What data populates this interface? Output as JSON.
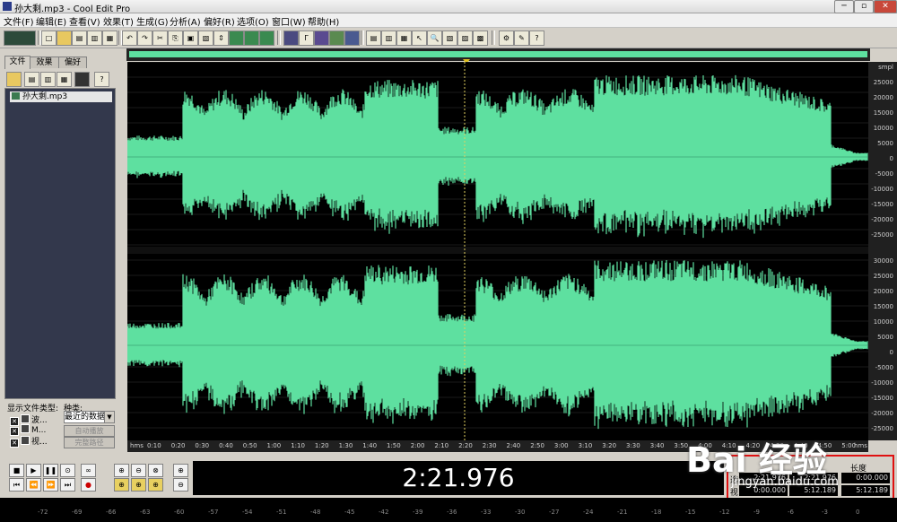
{
  "window": {
    "title": "孙大剩.mp3 - Cool Edit Pro"
  },
  "menu": [
    "文件(F)",
    "编辑(E)",
    "查看(V)",
    "效果(T)",
    "生成(G)",
    "分析(A)",
    "偏好(R)",
    "选项(O)",
    "窗口(W)",
    "帮助(H)"
  ],
  "left_panel": {
    "tabs": [
      "文件",
      "效果",
      "偏好"
    ],
    "files": [
      "孙大剩.mp3"
    ],
    "show_file_types_label": "显示文件类型:",
    "type_label": "种类:",
    "file_types": [
      "波...",
      "M...",
      "视..."
    ],
    "type_select_value": "最近的数据",
    "buttons": [
      "自动播放",
      "完整路径"
    ]
  },
  "scale": {
    "top_labels": [
      "smpl",
      "25000",
      "20000",
      "15000",
      "10000",
      "5000",
      "0",
      "-5000",
      "-10000",
      "-15000",
      "-20000",
      "-25000"
    ],
    "bottom_labels": [
      "30000",
      "25000",
      "20000",
      "15000",
      "10000",
      "5000",
      "0",
      "-5000",
      "-10000",
      "-15000",
      "-20000",
      "-25000"
    ]
  },
  "timeline": {
    "start": "hms",
    "ticks": [
      "0:10",
      "0:20",
      "0:30",
      "0:40",
      "0:50",
      "1:00",
      "1:10",
      "1:20",
      "1:30",
      "1:40",
      "1:50",
      "2:00",
      "2:10",
      "2:20",
      "2:30",
      "2:40",
      "2:50",
      "3:00",
      "3:10",
      "3:20",
      "3:30",
      "3:40",
      "3:50",
      "4:00",
      "4:10",
      "4:20",
      "4:30",
      "4:40",
      "4:50",
      "5:00"
    ],
    "end": "hms"
  },
  "transport": {
    "time_display": "2:21.976"
  },
  "selection": {
    "header_length": "长度",
    "sel_label": "选",
    "view_label": "视",
    "sel_begin": "2:21.976",
    "sel_end": "2:21.976",
    "sel_length": "0:00.000",
    "view_begin": "0:00.000",
    "view_end": "5:12.189",
    "view_length": "5:12.189"
  },
  "status_ticks": [
    "-72",
    "-69",
    "-66",
    "-63",
    "-60",
    "-57",
    "-54",
    "-51",
    "-48",
    "-45",
    "-42",
    "-39",
    "-36",
    "-33",
    "-30",
    "-27",
    "-24",
    "-21",
    "-18",
    "-15",
    "-12",
    "-9",
    "-6",
    "-3",
    "0"
  ],
  "watermark": {
    "brand": "Bai 经验",
    "url": "jingyan.baidu.com"
  },
  "colors": {
    "waveform": "#5ee0a0",
    "background": "#000000",
    "highlight": "#e01010"
  }
}
